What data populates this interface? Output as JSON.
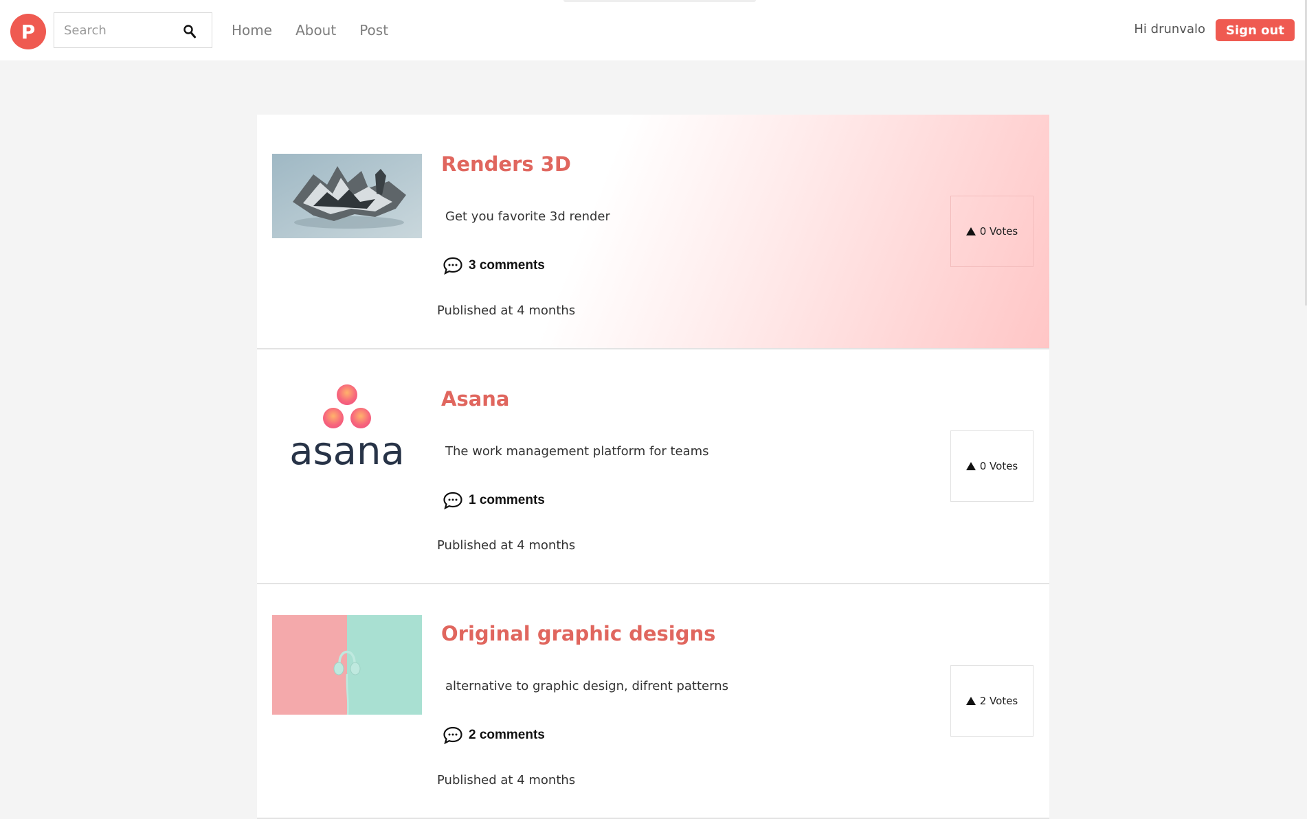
{
  "header": {
    "logo_letter": "P",
    "search_placeholder": "Search",
    "nav": [
      "Home",
      "About",
      "Post"
    ],
    "greeting": "Hi drunvalo",
    "signout_label": "Sign out",
    "accent_color": "#ef5a51"
  },
  "posts": [
    {
      "title": "Renders 3D",
      "description": "Get you favorite 3d render",
      "comments": "3 comments",
      "published": "Published at 4 months",
      "votes": "0 Votes",
      "image": "3d-render-sculpture",
      "highlighted": true
    },
    {
      "title": "Asana",
      "description": "The work management platform for teams",
      "comments": "1 comments",
      "published": "Published at 4 months",
      "votes": "0 Votes",
      "image": "asana-logo",
      "logo_text": "asana"
    },
    {
      "title": "Original graphic designs",
      "description": "alternative to graphic design, difrent patterns",
      "comments": "2 comments",
      "published": "Published at 4 months",
      "votes": "2 Votes",
      "image": "headphones-on-pink-and-mint"
    }
  ]
}
